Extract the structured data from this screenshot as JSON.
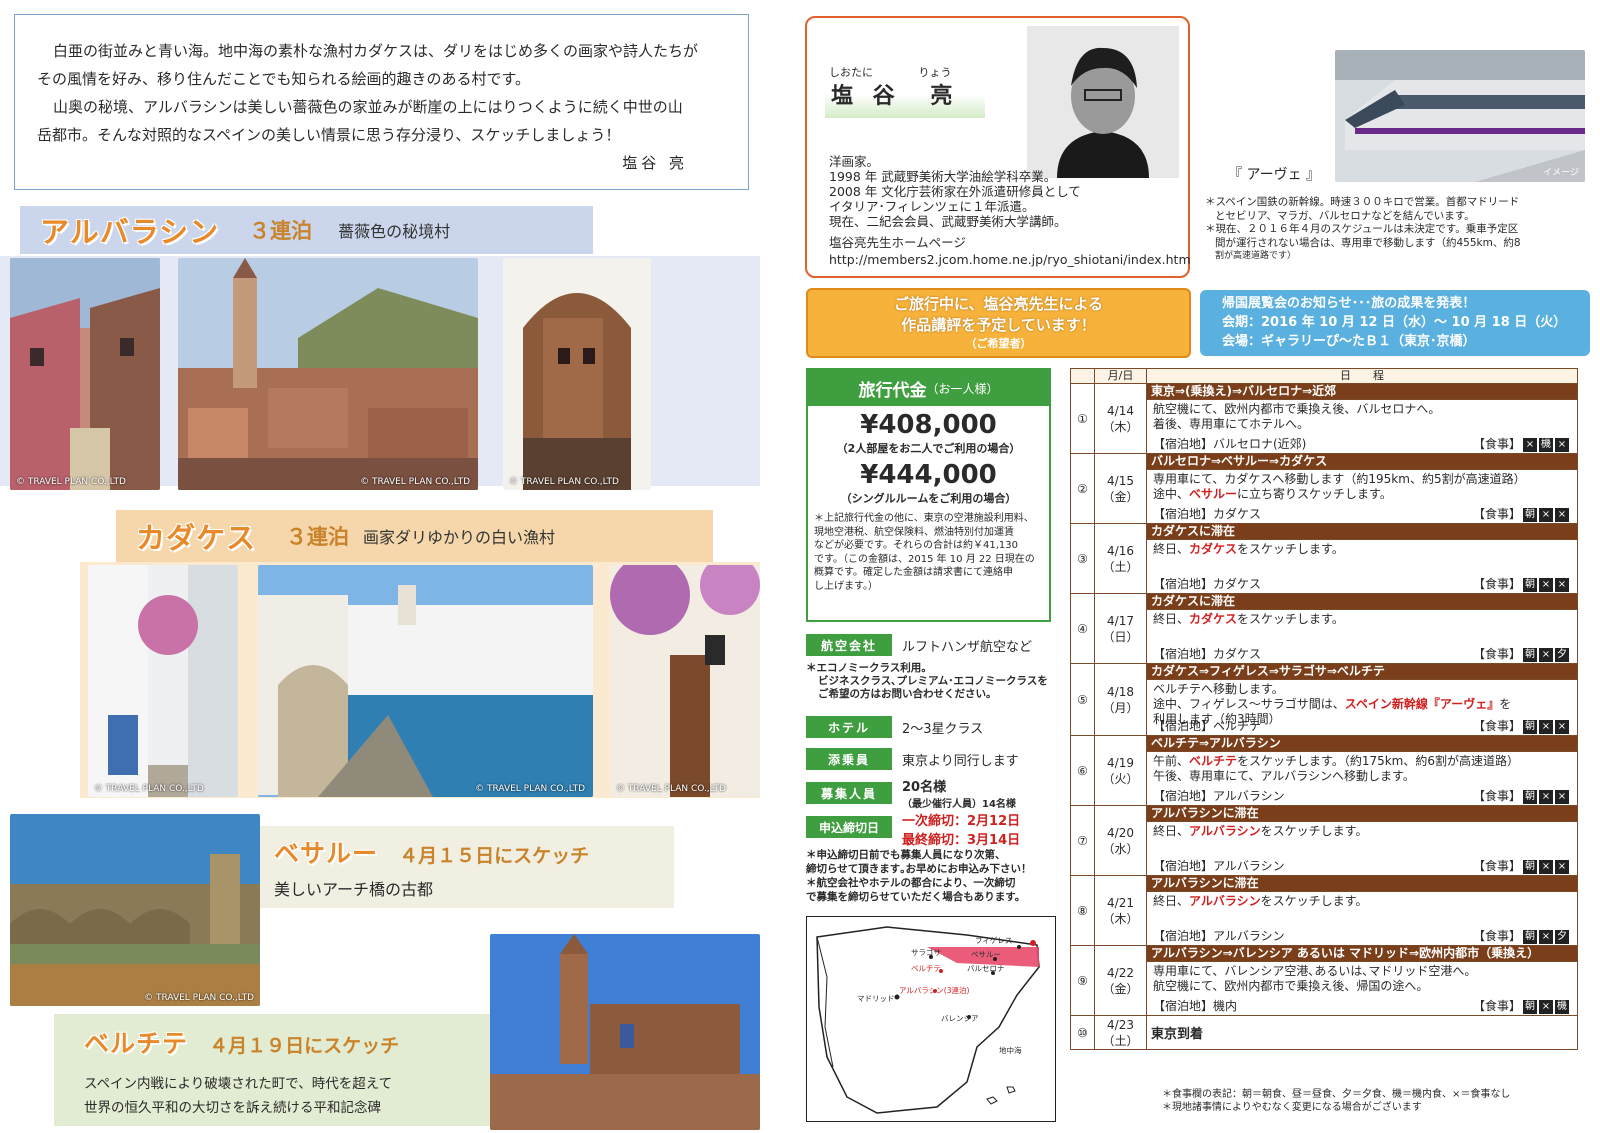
{
  "intro": {
    "line1": "白亜の街並みと青い海。地中海の素朴な漁村カダケスは、ダリをはじめ多くの画家や詩人たちが",
    "line2": "その風情を好み、移り住んだことでも知られる絵画的趣きのある村です。",
    "line3": "山奥の秘境、アルバラシンは美しい薔薇色の家並みが断崖の上にはりつくように続く中世の山",
    "line4": "岳都市。そんな対照的なスペインの美しい情景に思う存分浸り、スケッチしましょう！",
    "signature": "塩谷 亮"
  },
  "copyright": "© TRAVEL PLAN CO.,LTD",
  "albarracin": {
    "title": "アルバラシン",
    "nights": "３連泊",
    "subtitle": "薔薇色の秘境村"
  },
  "cadaques": {
    "title": "カダケス",
    "nights": "３連泊",
    "subtitle": "画家ダリゆかりの白い漁村"
  },
  "besalu": {
    "title": "ベサルー",
    "date": "４月１５日にスケッチ",
    "subtitle": "美しいアーチ橋の古都"
  },
  "belchite": {
    "title": "ベルチテ",
    "date": "４月１９日にスケッチ",
    "desc1": "スペイン内戦により破壊された町で、時代を超えて",
    "desc2": "世界の恒久平和の大切さを訴え続ける平和記念碑"
  },
  "profile": {
    "ruby_family": "しおたに",
    "ruby_given": "りょう",
    "name_family": "塩 谷",
    "name_given": "亮",
    "bio1": "洋画家。",
    "bio2": "1998 年 武蔵野美術大学油絵学科卒業。",
    "bio3": "2008 年 文化庁芸術家在外派遣研修員として",
    "bio4": "イタリア･フィレンツェに１年派遣。",
    "bio5": "現在、二紀会会員、武蔵野美術大学講師。",
    "hp_label": "塩谷亮先生ホームページ",
    "hp_url": "http://members2.jcom.home.ne.jp/ryo_shiotani/index.htm"
  },
  "ave": {
    "caption": "『 アーヴェ 』",
    "image_label": "イメージ",
    "note1": "＊スペイン国鉄の新幹線。時速３００キロで営業。首都マドリード",
    "note2": "とセビリア、マラガ、バルセロナなどを結んでいます。",
    "note3": "＊現在、２０１６年４月のスケジュールは未決定です。乗車予定区",
    "note4": "間が運行されない場合は、専用車で移動します（約455km、約8",
    "note5": "割が高速道路です）"
  },
  "critique": {
    "line1": "ご旅行中に、塩谷亮先生による",
    "line2": "作品講評を予定しています！",
    "line3": "（ご希望者）"
  },
  "exhibition": {
    "title": "帰国展覧会のお知らせ･･･旅の成果を発表！",
    "period": "会期：2016 年 10 月 12 日（水）～ 10 月 18 日（火）",
    "venue": "会場：ギャラリーぴ～たＢ１（東京･京橋）"
  },
  "price": {
    "header": "旅行代金",
    "header_sub": "（お一人様）",
    "twin_price": "¥408,000",
    "twin_note": "（2人部屋をお二人でご利用の場合）",
    "single_price": "¥444,000",
    "single_note": "（シングルルームをご利用の場合）",
    "fine1": "＊上記旅行代金の他に、東京の空港施設利用料、",
    "fine2": "現地空港税、航空保険料、燃油特別付加運賃",
    "fine3": "などが必要です。それらの合計は約￥41,130",
    "fine4": "です。（この金額は、2015 年 10 月 22 日現在の",
    "fine5": "概算です。確定した金額は請求書にて連絡申",
    "fine6": "し上げます。）"
  },
  "info": {
    "airline_label": "航空会社",
    "airline_value": "ルフトハンザ航空など",
    "economy1": "＊エコノミークラス利用。",
    "economy2": "ビジネスクラス､プレミアム･エコノミークラスを",
    "economy3": "ご希望の方はお問い合わせください。",
    "hotel_label": "ホテル",
    "hotel_value": "2～3星クラス",
    "guide_label": "添乗員",
    "guide_value": "東京より同行します",
    "capacity_label": "募集人員",
    "capacity_value": "20名様",
    "capacity_min": "（最少催行人員）14名様",
    "deadline_label": "申込締切日",
    "deadline1": "一次締切：2月12日",
    "deadline2": "最終締切：3月14日",
    "cut1": "＊申込締切日前でも募集人員になり次第、",
    "cut2": "締切らせて頂きます｡お早めにお申込み下さい！",
    "cut3": "＊航空会社やホテルの都合により、一次締切",
    "cut4": "で募集を締切らせていただく場合もあります。"
  },
  "map": {
    "cadaques": "カダケス(3連泊)",
    "figueres": "フィゲレス",
    "besalu": "ベサルー",
    "zaragoza": "サラゴサ",
    "belchite": "ベルチテ",
    "barcelona": "バルセロナ",
    "madrid": "マドリッド",
    "albarracin": "アルバラシン(3連泊)",
    "valencia": "バレンシア",
    "sea": "地中海"
  },
  "schedule": {
    "col_date": "月/日",
    "col_plan": "日　　程",
    "days": [
      {
        "no": "①",
        "date": "4/14",
        "dow": "（木）",
        "route": "東京⇒(乗換え)⇒バルセロナ⇒近郊",
        "l1": "航空機にて、欧州内都市で乗換え後、バルセロナへ。",
        "l2": "着後、専用車にてホテルへ。",
        "stay": "【宿泊地】バルセロナ(近郊)",
        "meal_label": "【食事】",
        "meals": [
          "×",
          "機",
          "×"
        ]
      },
      {
        "no": "②",
        "date": "4/15",
        "dow": "（金）",
        "route": "バルセロナ⇒ベサルー⇒カダケス",
        "l1": "専用車にて、カダケスへ移動します（約195km、約5割が高速道路）",
        "l2a": "途中、",
        "l2b": "ベサルー",
        "l2c": "に立ち寄りスケッチします。",
        "stay": "【宿泊地】カダケス",
        "meal_label": "【食事】",
        "meals": [
          "朝",
          "×",
          "×"
        ]
      },
      {
        "no": "③",
        "date": "4/16",
        "dow": "（土）",
        "route": "カダケスに滞在",
        "l1a": "終日、",
        "l1b": "カダケス",
        "l1c": "をスケッチします。",
        "stay": "【宿泊地】カダケス",
        "meal_label": "【食事】",
        "meals": [
          "朝",
          "×",
          "×"
        ]
      },
      {
        "no": "④",
        "date": "4/17",
        "dow": "（日）",
        "route": "カダケスに滞在",
        "l1a": "終日、",
        "l1b": "カダケス",
        "l1c": "をスケッチします。",
        "stay": "【宿泊地】カダケス",
        "meal_label": "【食事】",
        "meals": [
          "朝",
          "×",
          "夕"
        ]
      },
      {
        "no": "⑤",
        "date": "4/18",
        "dow": "（月）",
        "route": "カダケス⇒フィゲレス⇒サラゴサ⇒ベルチテ",
        "l1": "ベルチテへ移動します。",
        "l2a": "途中、フィゲレス～サラゴサ間は、",
        "l2b": "スペイン新幹線『アーヴェ』",
        "l2c": "を",
        "l3": "利用します（約3時間）",
        "stay": "【宿泊地】ベルチテ",
        "meal_label": "【食事】",
        "meals": [
          "朝",
          "×",
          "×"
        ]
      },
      {
        "no": "⑥",
        "date": "4/19",
        "dow": "（火）",
        "route": "ベルチテ⇒アルバラシン",
        "l1a": "午前、",
        "l1b": "ベルチテ",
        "l1c": "をスケッチします。（約175km、約6割が高速道路）",
        "l2": "午後、専用車にて、アルバラシンへ移動します。",
        "stay": "【宿泊地】アルバラシン",
        "meal_label": "【食事】",
        "meals": [
          "朝",
          "×",
          "×"
        ]
      },
      {
        "no": "⑦",
        "date": "4/20",
        "dow": "（水）",
        "route": "アルバラシンに滞在",
        "l1a": "終日、",
        "l1b": "アルバラシン",
        "l1c": "をスケッチします。",
        "stay": "【宿泊地】アルバラシン",
        "meal_label": "【食事】",
        "meals": [
          "朝",
          "×",
          "×"
        ]
      },
      {
        "no": "⑧",
        "date": "4/21",
        "dow": "（木）",
        "route": "アルバラシンに滞在",
        "l1a": "終日、",
        "l1b": "アルバラシン",
        "l1c": "をスケッチします。",
        "stay": "【宿泊地】アルバラシン",
        "meal_label": "【食事】",
        "meals": [
          "朝",
          "×",
          "夕"
        ]
      },
      {
        "no": "⑨",
        "date": "4/22",
        "dow": "（金）",
        "route": "アルバラシン⇒バレンシア あるいは マドリッド⇒欧州内都市（乗換え）",
        "l1": "専用車にて、バレンシア空港､あるいは､マドリッド空港へ。",
        "l2": "航空機にて、欧州内都市で乗換え後、帰国の途へ。",
        "stay": "【宿泊地】機内",
        "meal_label": "【食事】",
        "meals": [
          "朝",
          "×",
          "機"
        ]
      },
      {
        "no": "⑩",
        "date": "4/23",
        "dow": "（土）",
        "route": "東京到着"
      }
    ],
    "legend": "＊食事欄の表記：朝＝朝食、昼＝昼食、夕＝夕食、機＝機内食、×＝食事なし",
    "legend2": "＊現地諸事情によりやむなく変更になる場合がございます"
  }
}
